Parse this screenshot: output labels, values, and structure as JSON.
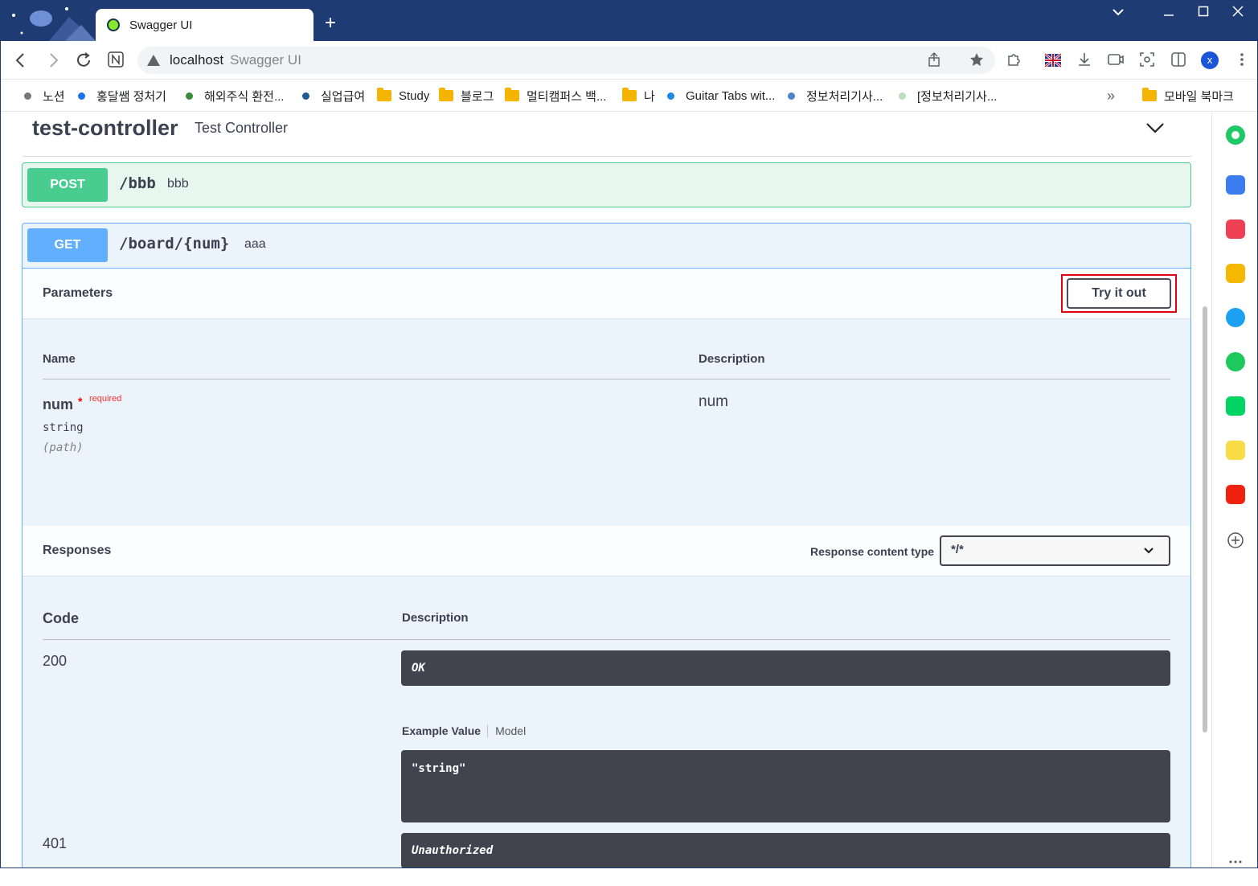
{
  "browser": {
    "tab_title": "Swagger UI",
    "new_tab": "+",
    "url_host": "localhost",
    "url_title": "Swagger UI",
    "avatar_letter": "x",
    "bookmarks": [
      {
        "label": "노션",
        "type": "dot",
        "color": "#777777"
      },
      {
        "label": "홍달쌤 정처기",
        "type": "dot",
        "color": "#1a73e8"
      },
      {
        "label": "해외주식 환전...",
        "type": "dot",
        "color": "#3c8a3c"
      },
      {
        "label": "실업급여",
        "type": "dot",
        "color": "#1f5a99"
      },
      {
        "label": "Study",
        "type": "folder"
      },
      {
        "label": "블로그",
        "type": "folder"
      },
      {
        "label": "멀티캠퍼스 백...",
        "type": "folder"
      },
      {
        "label": "나",
        "type": "folder"
      },
      {
        "label": "Guitar Tabs wit...",
        "type": "dot",
        "color": "#1e88e5"
      },
      {
        "label": "정보처리기사...",
        "type": "dot",
        "color": "#4a86c8"
      },
      {
        "label": "[정보처리기사...",
        "type": "dot",
        "color": "#b8e0c0"
      }
    ],
    "bookmarks_overflow": "»",
    "mobile_bookmarks": "모바일 북마크"
  },
  "swagger": {
    "controller_name": "test-controller",
    "controller_desc": "Test Controller",
    "post_op": {
      "method": "POST",
      "path": "/bbb",
      "summary": "bbb"
    },
    "get_op": {
      "method": "GET",
      "path": "/board/{num}",
      "summary": "aaa"
    },
    "parameters": {
      "title": "Parameters",
      "try_it_out": "Try it out",
      "col_name": "Name",
      "col_description": "Description",
      "param": {
        "name": "num",
        "star": "*",
        "required": "required",
        "type": "string",
        "in": "(path)",
        "description": "num"
      }
    },
    "responses": {
      "title": "Responses",
      "content_type_label": "Response content type",
      "content_type_value": "*/*",
      "col_code": "Code",
      "col_description": "Description",
      "items": [
        {
          "code": "200",
          "description": "OK",
          "example_tab_active": "Example Value",
          "example_tab_inactive": "Model",
          "example": "\"string\""
        },
        {
          "code": "401",
          "description": "Unauthorized"
        }
      ]
    }
  },
  "colors": {
    "post": "#49cc90",
    "get": "#61affe",
    "highlight": "#e00010",
    "titlebar": "#1f3b73"
  }
}
